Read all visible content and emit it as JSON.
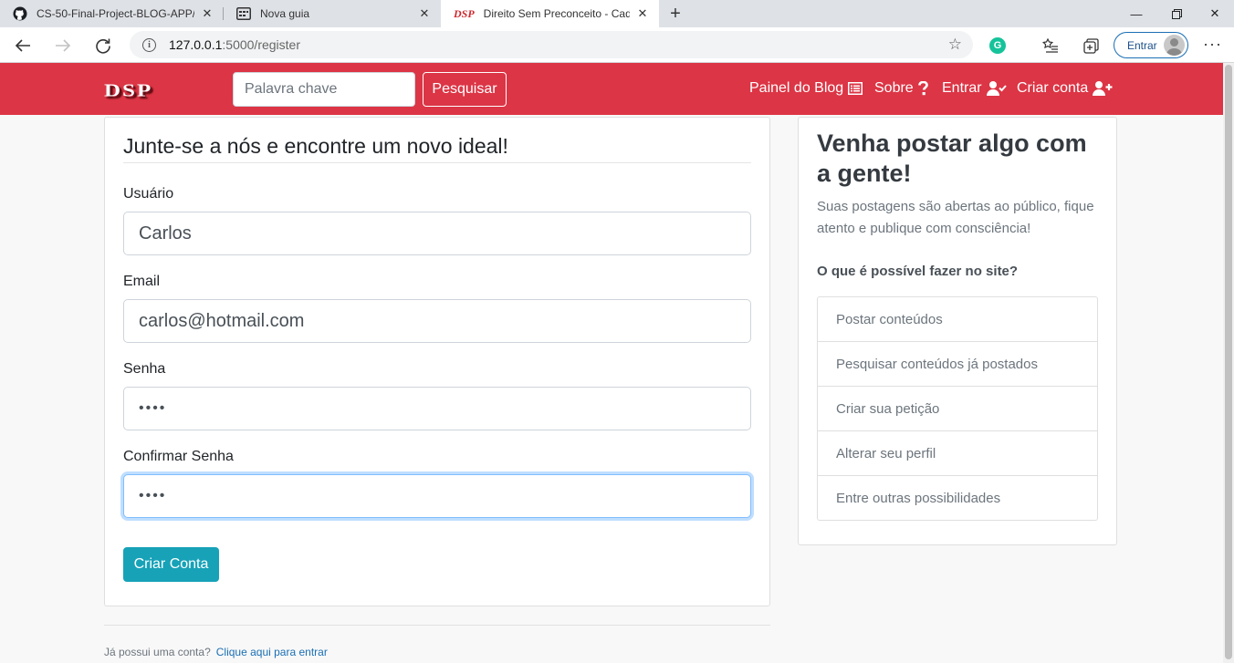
{
  "browser": {
    "tabs": [
      {
        "title": "CS-50-Final-Project-BLOG-APP/a",
        "icon": "github-icon"
      },
      {
        "title": "Nova guia",
        "icon": "newtab-page-icon"
      },
      {
        "title": "Direito Sem Preconceito - Cadas",
        "icon": "dsp-favicon"
      }
    ],
    "favicon_text": "DSP",
    "url_host": "127.0.0.1",
    "url_path": ":5000/register",
    "signin_label": "Entrar",
    "grammarly_letter": "G"
  },
  "navbar": {
    "logo": "DSP",
    "search_placeholder": "Palavra chave",
    "search_button": "Pesquisar",
    "links": {
      "blog_panel": "Painel do Blog",
      "about": "Sobre",
      "login": "Entrar",
      "register": "Criar conta"
    }
  },
  "form": {
    "legend": "Junte-se a nós e encontre um novo ideal!",
    "username": {
      "label": "Usuário",
      "value": "Carlos"
    },
    "email": {
      "label": "Email",
      "value": "carlos@hotmail.com"
    },
    "password": {
      "label": "Senha",
      "value": "••••"
    },
    "confirm_password": {
      "label": "Confirmar Senha",
      "value": "••••"
    },
    "submit": "Criar Conta"
  },
  "footer": {
    "text": "Já possui uma conta?",
    "link": "Clique aqui para entrar"
  },
  "sidebar": {
    "title": "Venha postar algo com a gente!",
    "text": "Suas postagens são abertas ao público, fique atento e publique com consciência!",
    "question": "O que é possível fazer no site?",
    "items": [
      "Postar conteúdos",
      "Pesquisar conteúdos já postados",
      "Criar sua petição",
      "Alterar seu perfil",
      "Entre outras possibilidades"
    ]
  },
  "colors": {
    "navbar": "#dc3545",
    "submit": "#17a2b8",
    "link": "#1a6fb4"
  }
}
